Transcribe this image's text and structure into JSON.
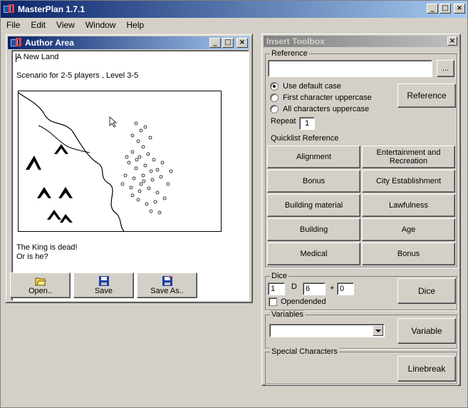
{
  "app": {
    "title": "MasterPlan 1.7.1",
    "minimize": "_",
    "maximize": "□",
    "close": "×"
  },
  "menu": [
    "File",
    "Edit",
    "View",
    "Window",
    "Help"
  ],
  "author_area": {
    "title": "Author Area",
    "lines": [
      "A New Land",
      "Scenario for 2-5 players , Level 3-5",
      "The King is dead!",
      "Or is he?"
    ],
    "buttons": {
      "open": "Open..",
      "save": "Save",
      "save_as": "Save As.."
    }
  },
  "toolbox": {
    "title": "Insert Toolbox",
    "reference": {
      "legend": "Reference",
      "input_value": "",
      "browse_label": "...",
      "radios": [
        {
          "label": "Use default case",
          "checked": true
        },
        {
          "label": "First character uppercase",
          "checked": false
        },
        {
          "label": "All characters uppercase",
          "checked": false
        }
      ],
      "repeat_label": "Repeat",
      "repeat_value": "1",
      "reference_button": "Reference",
      "quicklist_label": "Quicklist Reference",
      "quicklist": [
        "Alignment",
        "Entertainment and Recreation",
        "Bonus",
        "City Establishment",
        "Building material",
        "Lawfulness",
        "Building",
        "Age",
        "Medical",
        "Bonus"
      ]
    },
    "dice": {
      "legend": "Dice",
      "count": "1",
      "d_label": "D",
      "sides": "6",
      "plus_label": "+",
      "modifier": "0",
      "openended_label": "Opendended",
      "dice_button": "Dice"
    },
    "variables": {
      "legend": "Variables",
      "selected": "",
      "variable_button": "Variable"
    },
    "special": {
      "legend": "Special Characters",
      "linebreak_button": "Linebreak"
    }
  }
}
